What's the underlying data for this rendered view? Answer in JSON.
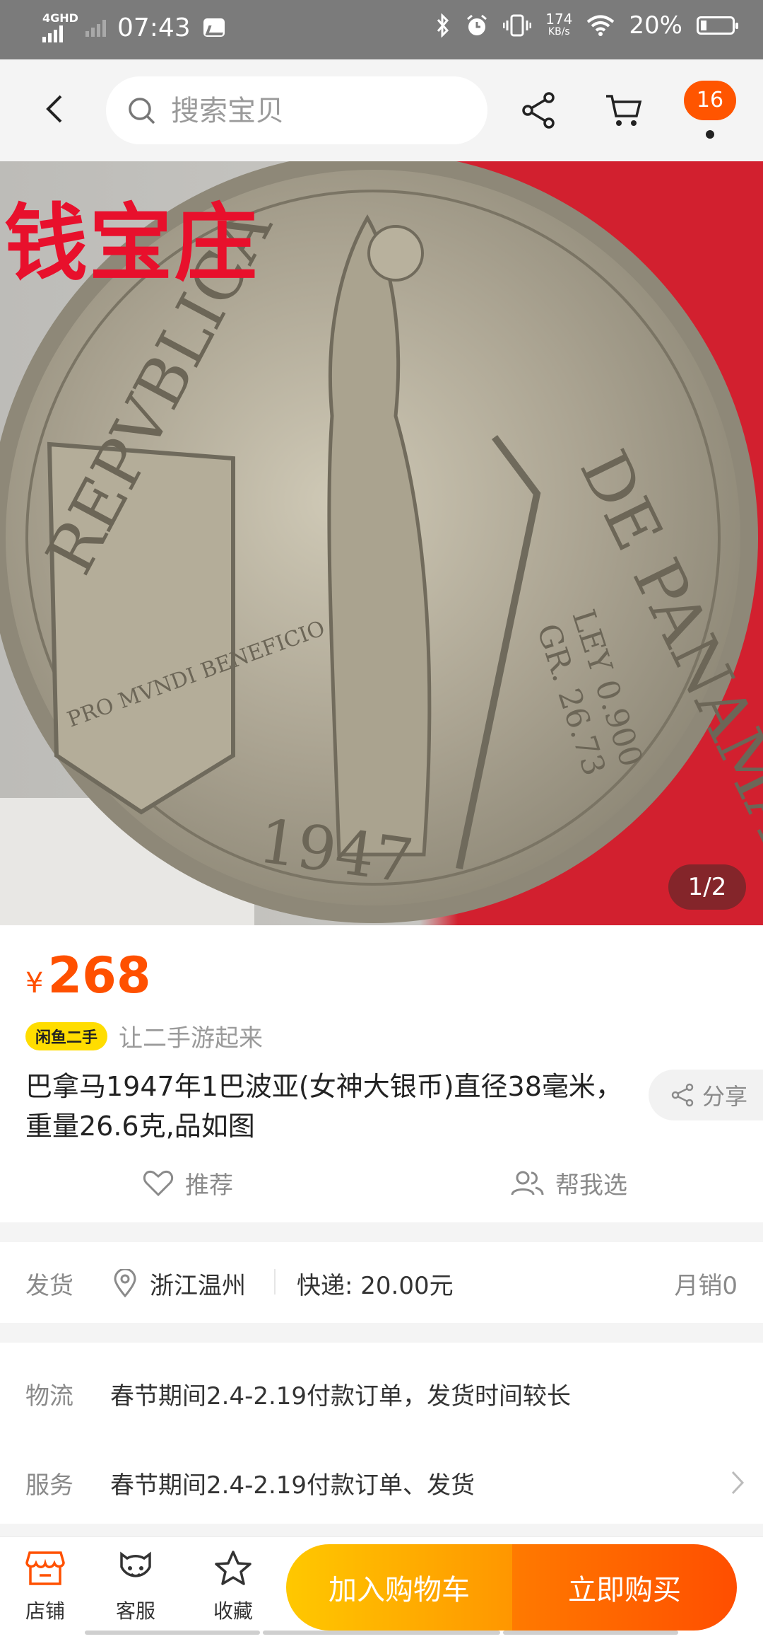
{
  "status_bar": {
    "network": "4GHD",
    "time": "07:43",
    "speed_value": "174",
    "speed_unit": "KB/s",
    "battery": "20%"
  },
  "header": {
    "search_placeholder": "搜索宝贝",
    "message_badge": "16"
  },
  "gallery": {
    "watermark": "钱宝庄",
    "counter": "1/2",
    "coin_year": "1947",
    "coin_legend_left": "REPVBLICA",
    "coin_legend_right": "DE PANAMA",
    "coin_ley": "LEY 0.900",
    "coin_weight": "GR. 26.73",
    "coin_motto": "PRO MVNDI BENEFICIO"
  },
  "product": {
    "currency": "¥",
    "price": "268",
    "tag": "闲鱼二手",
    "slogan": "让二手游起来",
    "title": "巴拿马1947年1巴波亚(女神大银币)直径38毫米，重量26.6克,品如图",
    "share_label": "分享",
    "recommend_label": "推荐",
    "help_choose_label": "帮我选"
  },
  "shipping": {
    "label": "发货",
    "location": "浙江温州",
    "express": "快递: 20.00元",
    "monthly_sales": "月销0"
  },
  "services": {
    "logistics_label": "物流",
    "logistics_value": "春节期间2.4-2.19付款订单，发货时间较长",
    "service_label": "服务",
    "service_value": "春节期间2.4-2.19付款订单、发货"
  },
  "bottom_bar": {
    "store_label": "店铺",
    "service_label": "客服",
    "favorite_label": "收藏",
    "add_to_cart": "加入购物车",
    "buy_now": "立即购买"
  },
  "colors": {
    "accent": "#ff5000",
    "cart_gradient_start": "#ffc800",
    "buy_gradient_end": "#ff4e00"
  }
}
